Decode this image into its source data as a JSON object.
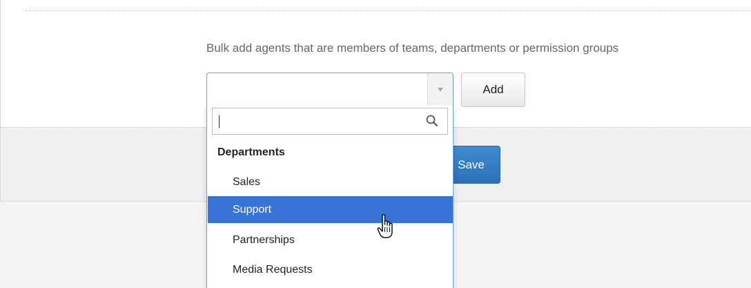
{
  "bulk_add": {
    "help_text": "Bulk add agents that are members of teams, departments or permission groups",
    "select_value": "",
    "add_label": "Add"
  },
  "footer": {
    "save_label": "Save"
  },
  "dropdown": {
    "search_value": "",
    "search_icon": "magnifier-icon",
    "group_label": "Departments",
    "options": [
      {
        "label": "Sales",
        "highlighted": false
      },
      {
        "label": "Support",
        "highlighted": true
      },
      {
        "label": "Partnerships",
        "highlighted": false
      },
      {
        "label": "Media Requests",
        "highlighted": false
      }
    ]
  },
  "colors": {
    "primary_button": "#2b70b6",
    "highlight": "#3874d6",
    "focus_border": "#6e9fd8"
  },
  "cursor_icon": "hand-pointer-icon"
}
